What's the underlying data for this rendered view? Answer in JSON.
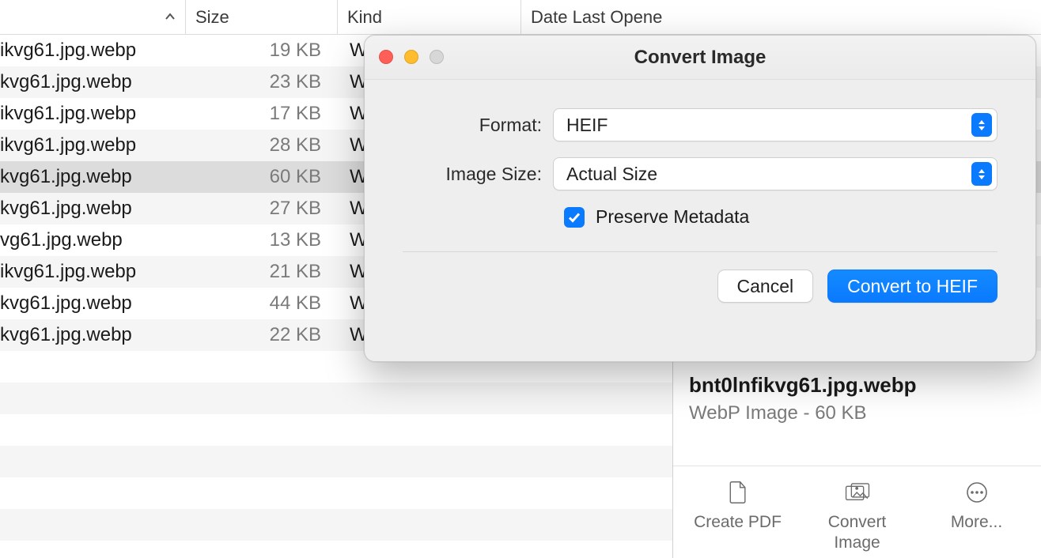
{
  "columns": {
    "name_sort_indicator": "ascending",
    "size": "Size",
    "kind": "Kind",
    "date": "Date Last Opene"
  },
  "rows": [
    {
      "name": "ikvg61.jpg.webp",
      "size": "19 KB",
      "kind": "W",
      "selected": false
    },
    {
      "name": "kvg61.jpg.webp",
      "size": "23 KB",
      "kind": "W",
      "selected": false
    },
    {
      "name": "ikvg61.jpg.webp",
      "size": "17 KB",
      "kind": "W",
      "selected": false
    },
    {
      "name": "ikvg61.jpg.webp",
      "size": "28 KB",
      "kind": "W",
      "selected": false
    },
    {
      "name": "kvg61.jpg.webp",
      "size": "60 KB",
      "kind": "W",
      "selected": true
    },
    {
      "name": "kvg61.jpg.webp",
      "size": "27 KB",
      "kind": "W",
      "selected": false
    },
    {
      "name": "vg61.jpg.webp",
      "size": "13 KB",
      "kind": "W",
      "selected": false
    },
    {
      "name": "ikvg61.jpg.webp",
      "size": "21 KB",
      "kind": "W",
      "selected": false
    },
    {
      "name": "kvg61.jpg.webp",
      "size": "44 KB",
      "kind": "W",
      "selected": false
    },
    {
      "name": "kvg61.jpg.webp",
      "size": "22 KB",
      "kind": "W",
      "selected": false
    }
  ],
  "preview": {
    "filename": "bnt0lnfikvg61.jpg.webp",
    "subtitle": "WebP Image - 60 KB",
    "actions": {
      "create_pdf": "Create PDF",
      "convert_image": "Convert\nImage",
      "more": "More..."
    }
  },
  "dialog": {
    "title": "Convert Image",
    "format_label": "Format:",
    "format_value": "HEIF",
    "size_label": "Image Size:",
    "size_value": "Actual Size",
    "preserve_label": "Preserve Metadata",
    "preserve_checked": true,
    "cancel": "Cancel",
    "confirm": "Convert to HEIF"
  }
}
